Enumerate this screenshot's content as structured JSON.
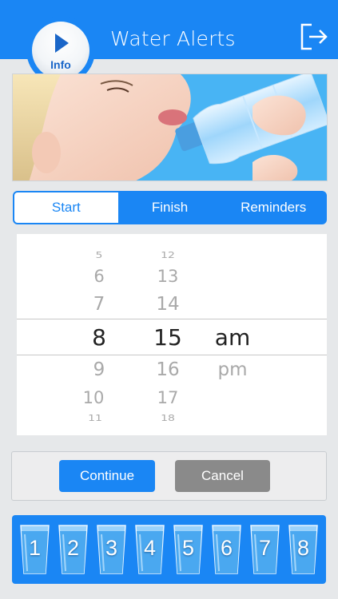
{
  "header": {
    "title": "Water Alerts",
    "info_label": "Info",
    "exit_icon": "exit-icon",
    "background_color": "#1a86f4"
  },
  "hero": {
    "icon": "woman-drinking-water-photo"
  },
  "tabs": [
    {
      "label": "Start",
      "active": true
    },
    {
      "label": "Finish",
      "active": false
    },
    {
      "label": "Reminders",
      "active": false
    }
  ],
  "time_picker": {
    "hour_above": [
      "5",
      "6",
      "7"
    ],
    "hour_selected": "8",
    "hour_below": [
      "9",
      "10",
      "11"
    ],
    "minute_above": [
      "12",
      "13",
      "14"
    ],
    "minute_selected": "15",
    "minute_below": [
      "16",
      "17",
      "18"
    ],
    "period_selected": "am",
    "period_below": "pm"
  },
  "actions": {
    "continue_label": "Continue",
    "cancel_label": "Cancel"
  },
  "glasses": [
    "1",
    "2",
    "3",
    "4",
    "5",
    "6",
    "7",
    "8"
  ],
  "colors": {
    "accent": "#1a86f4",
    "cancel": "#8a8a8a"
  }
}
